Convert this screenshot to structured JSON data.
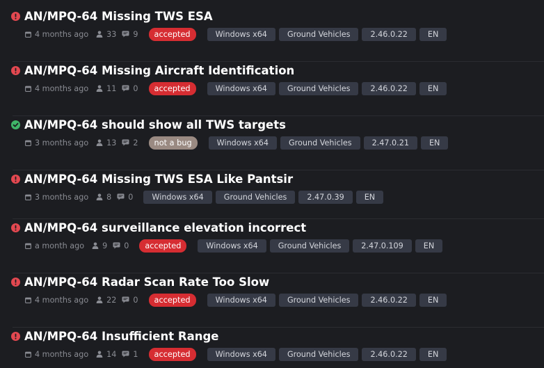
{
  "colors": {
    "bug_icon": "#e34850",
    "resolved_icon": "#3fb468",
    "accepted_badge": "#d62d32",
    "not_a_bug_badge": "#9a8a82"
  },
  "icons": {
    "bug": "exclamation-circle-icon",
    "resolved": "check-circle-icon",
    "date": "calendar-icon",
    "views": "person-icon",
    "comments": "comment-icon"
  },
  "issues": [
    {
      "title": "AN/MPQ-64 Missing TWS ESA",
      "status_icon": "bug",
      "time": "4 months ago",
      "views": "33",
      "comments": "9",
      "badge": "accepted",
      "tags": [
        "Windows x64",
        "Ground Vehicles",
        "2.46.0.22",
        "EN"
      ]
    },
    {
      "title": "AN/MPQ-64 Missing Aircraft Identification",
      "status_icon": "bug",
      "time": "4 months ago",
      "views": "11",
      "comments": "0",
      "badge": "accepted",
      "tags": [
        "Windows x64",
        "Ground Vehicles",
        "2.46.0.22",
        "EN"
      ]
    },
    {
      "title": "AN/MPQ-64 should show all TWS targets",
      "status_icon": "resolved",
      "time": "3 months ago",
      "views": "13",
      "comments": "2",
      "badge": "not a bug",
      "tags": [
        "Windows x64",
        "Ground Vehicles",
        "2.47.0.21",
        "EN"
      ]
    },
    {
      "title": "AN/MPQ-64 Missing TWS ESA Like Pantsir",
      "status_icon": "bug",
      "time": "3 months ago",
      "views": "8",
      "comments": "0",
      "badge": "",
      "tags": [
        "Windows x64",
        "Ground Vehicles",
        "2.47.0.39",
        "EN"
      ]
    },
    {
      "title": "AN/MPQ-64 surveillance elevation incorrect",
      "status_icon": "bug",
      "time": "a month ago",
      "views": "9",
      "comments": "0",
      "badge": "accepted",
      "tags": [
        "Windows x64",
        "Ground Vehicles",
        "2.47.0.109",
        "EN"
      ]
    },
    {
      "title": "AN/MPQ-64 Radar Scan Rate Too Slow",
      "status_icon": "bug",
      "time": "4 months ago",
      "views": "22",
      "comments": "0",
      "badge": "accepted",
      "tags": [
        "Windows x64",
        "Ground Vehicles",
        "2.46.0.22",
        "EN"
      ]
    },
    {
      "title": "AN/MPQ-64 Insufficient Range",
      "status_icon": "bug",
      "time": "4 months ago",
      "views": "14",
      "comments": "1",
      "badge": "accepted",
      "tags": [
        "Windows x64",
        "Ground Vehicles",
        "2.46.0.22",
        "EN"
      ]
    }
  ]
}
